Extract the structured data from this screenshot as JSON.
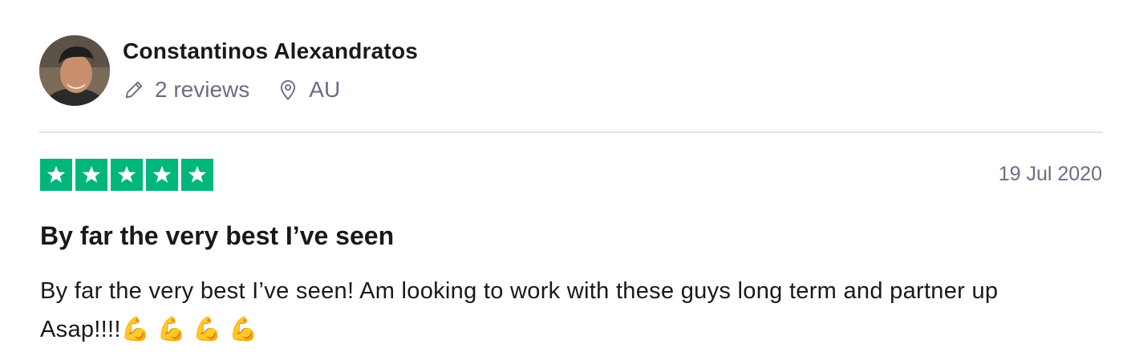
{
  "reviewer": {
    "name": "Constantinos Alexandratos",
    "reviews_count_label": "2 reviews",
    "location": "AU",
    "avatar_icon": "user-photo-avatar",
    "review_count_icon": "pencil-icon",
    "location_icon": "location-pin-icon"
  },
  "review": {
    "rating": 5,
    "rating_max": 5,
    "star_color": "#00b67a",
    "date": "19 Jul 2020",
    "title": "By far the very best I’ve seen",
    "text": "By far the very best I’ve seen! Am looking to work with these guys long term and partner up Asap!!!!💪 💪 💪 💪"
  },
  "colors": {
    "text": "#191919",
    "muted": "#6c6c85",
    "divider": "#e1e1e6"
  }
}
